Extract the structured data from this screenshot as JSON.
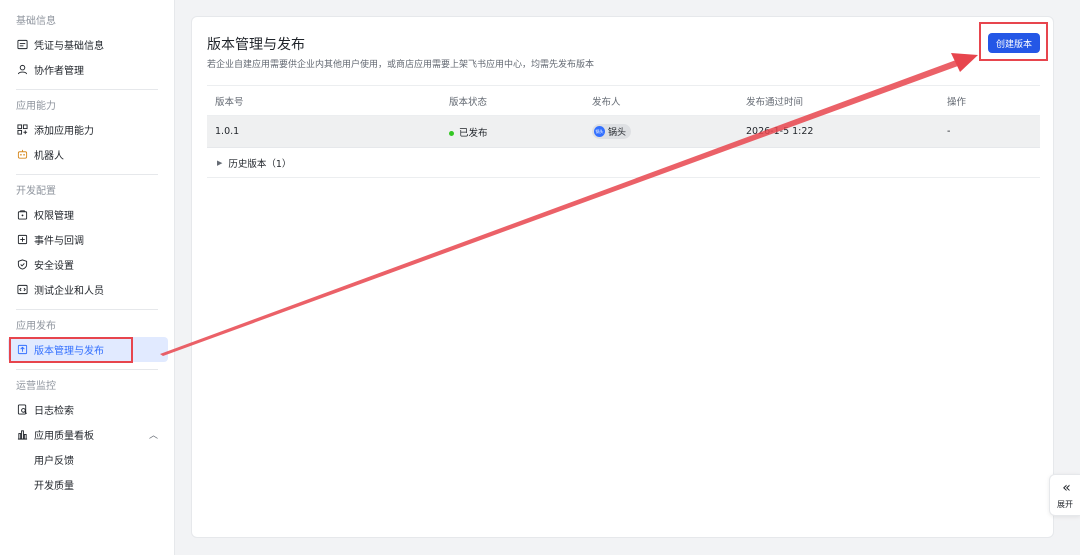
{
  "sidebar": {
    "groups": [
      {
        "title": "基础信息",
        "items": [
          {
            "label": "凭证与基础信息",
            "icon": "credential-icon"
          },
          {
            "label": "协作者管理",
            "icon": "user-icon"
          }
        ]
      },
      {
        "title": "应用能力",
        "items": [
          {
            "label": "添加应用能力",
            "icon": "add-capability-icon"
          },
          {
            "label": "机器人",
            "icon": "robot-icon"
          }
        ]
      },
      {
        "title": "开发配置",
        "items": [
          {
            "label": "权限管理",
            "icon": "permission-icon"
          },
          {
            "label": "事件与回调",
            "icon": "event-icon"
          },
          {
            "label": "安全设置",
            "icon": "shield-icon"
          },
          {
            "label": "测试企业和人员",
            "icon": "code-icon"
          }
        ]
      },
      {
        "title": "应用发布",
        "items": [
          {
            "label": "版本管理与发布",
            "icon": "upload-icon",
            "active": true
          }
        ]
      },
      {
        "title": "运营监控",
        "items": [
          {
            "label": "日志检索",
            "icon": "log-search-icon"
          },
          {
            "label": "应用质量看板",
            "icon": "bar-chart-icon",
            "expanded": true
          },
          {
            "label": "用户反馈",
            "sub": true
          },
          {
            "label": "开发质量",
            "sub": true
          }
        ]
      }
    ]
  },
  "main": {
    "title": "版本管理与发布",
    "description": "若企业自建应用需要供企业内其他用户使用，或商店应用需要上架飞书应用中心，均需先发布版本",
    "create_button": "创建版本",
    "table": {
      "headers": [
        "版本号",
        "版本状态",
        "发布人",
        "发布通过时间",
        "操作"
      ],
      "rows": [
        {
          "version": "1.0.1",
          "status": "已发布",
          "publisher": "锅头",
          "publisher_avatar": "锅头",
          "time": "2026-1-5 1:22",
          "action": "-"
        }
      ],
      "history_label": "历史版本（1）"
    }
  },
  "expand_button": {
    "icon": "«",
    "label": "展开"
  },
  "colors": {
    "accent": "#3370ff",
    "primary_button": "#2457e6",
    "annotation": "#e7454d",
    "status_green": "#34c724"
  }
}
